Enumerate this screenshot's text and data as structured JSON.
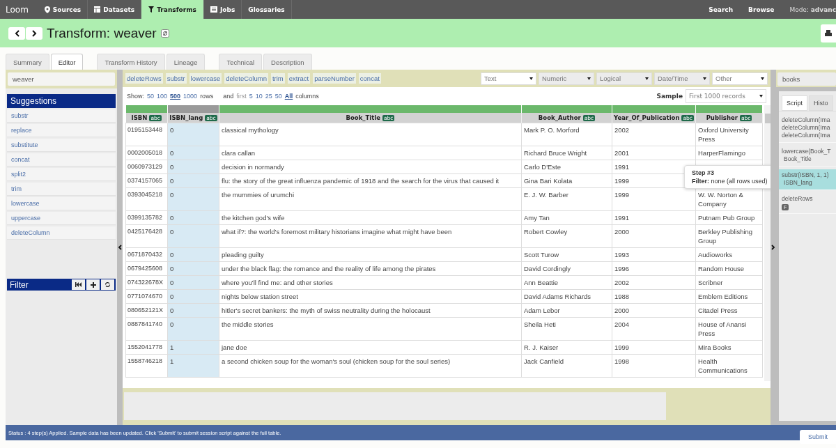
{
  "nav": {
    "brand": "Loom",
    "items": [
      {
        "label": "Sources",
        "selected": false
      },
      {
        "label": "Datasets",
        "selected": false
      },
      {
        "label": "Transforms",
        "selected": true
      },
      {
        "label": "Jobs",
        "selected": false
      },
      {
        "label": "Glossaries",
        "selected": false
      }
    ],
    "right": [
      "Search",
      "Browse"
    ],
    "mode": "Mode: **advanc**"
  },
  "header": {
    "title": "Transform: weaver"
  },
  "tab_groups": [
    [
      {
        "label": "Summary",
        "selected": false
      },
      {
        "label": "Editor",
        "selected": true
      }
    ],
    [
      {
        "label": "Transform History",
        "selected": false
      },
      {
        "label": "Lineage",
        "selected": false
      }
    ],
    [
      {
        "label": "Technical",
        "selected": false
      },
      {
        "label": "Description",
        "selected": false
      }
    ]
  ],
  "left": {
    "search_value": "weaver",
    "suggestions_title": "Suggestions",
    "suggestions": [
      "substr",
      "replace",
      "substitute",
      "concat",
      "split2",
      "trim",
      "lowercase",
      "uppercase",
      "deleteColumn"
    ],
    "filter_title": "Filter"
  },
  "functions": [
    "deleteRows",
    "substr",
    "lowercase",
    "deleteColumn",
    "trim",
    "extract",
    "parseNumber",
    "concat"
  ],
  "type_selects": [
    "Text",
    "Numeric",
    "Logical",
    "Date/Time",
    "Other"
  ],
  "dataset_field": "books",
  "show": {
    "prefix": "Show:",
    "row_options": [
      {
        "label": "50",
        "selected": false
      },
      {
        "label": "100",
        "selected": false
      },
      {
        "label": "500",
        "selected": true
      },
      {
        "label": "1000",
        "selected": false
      }
    ],
    "rows_label": "rows",
    "and_label": "and",
    "first_label": "first",
    "column_options": [
      {
        "label": "5",
        "selected": false
      },
      {
        "label": "10",
        "selected": false
      },
      {
        "label": "25",
        "selected": false
      },
      {
        "label": "50",
        "selected": false
      },
      {
        "label": "All",
        "selected": true
      }
    ],
    "columns_label": "columns"
  },
  "sample": {
    "label": "Sample",
    "value": "First 1000 records"
  },
  "table": {
    "columns": [
      {
        "name": "ISBN",
        "type": "abc",
        "selected": false
      },
      {
        "name": "ISBN_lang",
        "type": "abc",
        "selected": true
      },
      {
        "name": "Book_Title",
        "type": "abc",
        "selected": false
      },
      {
        "name": "Book_Author",
        "type": "abc",
        "selected": false
      },
      {
        "name": "Year_Of_Publication",
        "type": "abc",
        "selected": false
      },
      {
        "name": "Publisher",
        "type": "abc",
        "selected": false
      }
    ],
    "rows": [
      [
        "0195153448",
        "0",
        "classical mythology",
        "Mark P. O. Morford",
        "2002",
        "Oxford University Press"
      ],
      [
        "0002005018",
        "0",
        "clara callan",
        "Richard Bruce Wright",
        "2001",
        "HarperFlamingo"
      ],
      [
        "0060973129",
        "0",
        "decision in normandy",
        "Carlo D'Este",
        "1991"
      ],
      [
        "0374157065",
        "0",
        "flu: the story of the great influenza pandemic of 1918 and the search for the virus that caused it",
        "Gina Bari Kolata",
        "1999"
      ],
      [
        "0393045218",
        "0",
        "the mummies of urumchi",
        "E. J. W. Barber",
        "1999",
        "W. W. Norton & Company"
      ],
      [
        "0399135782",
        "0",
        "the kitchen god's wife",
        "Amy Tan",
        "1991",
        "Putnam Pub Group"
      ],
      [
        "0425176428",
        "0",
        "what if?: the world's foremost military historians imagine what might have been",
        "Robert Cowley",
        "2000",
        "Berkley Publishing Group"
      ],
      [
        "0671870432",
        "0",
        "pleading guilty",
        "Scott Turow",
        "1993",
        "Audioworks"
      ],
      [
        "0679425608",
        "0",
        "under the black flag: the romance and the reality of life among the pirates",
        "David Cordingly",
        "1996",
        "Random House"
      ],
      [
        "074322678X",
        "0",
        "where you'll find me: and other stories",
        "Ann Beattie",
        "2002",
        "Scribner"
      ],
      [
        "0771074670",
        "0",
        "nights below station street",
        "David Adams Richards",
        "1988",
        "Emblem Editions"
      ],
      [
        "080652121X",
        "0",
        "hitler's secret bankers: the myth of swiss neutrality during the holocaust",
        "Adam Lebor",
        "2000",
        "Citadel Press"
      ],
      [
        "0887841740",
        "0",
        "the middle stories",
        "Sheila Heti",
        "2004",
        "House of Anansi Press"
      ],
      [
        "1552041778",
        "1",
        "jane doe",
        "R. J. Kaiser",
        "1999",
        "Mira Books"
      ],
      [
        "1558746218",
        "1",
        "a second chicken soup for the woman's soul (chicken soup for the soul series)",
        "Jack Canfield",
        "1998",
        "Health Communications"
      ]
    ]
  },
  "tooltip": {
    "title": "Step #3",
    "text": "**Filter:** none (all rows used)"
  },
  "script": {
    "tabs": [
      {
        "label": "Script",
        "selected": true
      },
      {
        "label": "Histo",
        "selected": false
      }
    ],
    "steps": [
      {
        "lines": [
          "deleteColumn(Ima",
          "deleteColumn(Ima",
          "deleteColumn(Ima"
        ],
        "selected": false
      },
      {
        "lines": [
          "lowercase(Book_T",
          "Book_Title"
        ],
        "selected": false
      },
      {
        "lines": [
          "substr(ISBN, 1, 1)",
          "ISBN_lang"
        ],
        "selected": true
      },
      {
        "lines": [
          "deleteRows"
        ],
        "selected": false,
        "badge": "F"
      }
    ]
  },
  "status": "Status : 4 step(s) Applied. Sample data has been updated. Click 'Submit' to submit session script against the full table.",
  "submit": "Submit"
}
